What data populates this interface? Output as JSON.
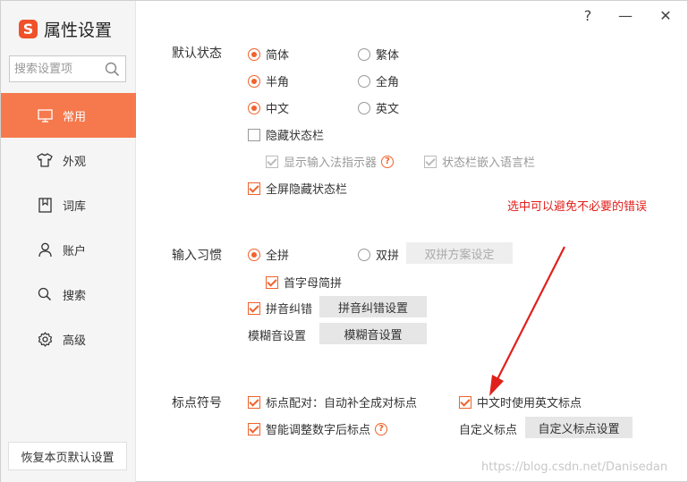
{
  "app": {
    "title": "属性设置",
    "logo_letter": "S"
  },
  "titlebar": {
    "help": "?",
    "minimize": "—",
    "close": "✕"
  },
  "sidebar": {
    "search_placeholder": "搜索设置项",
    "items": [
      {
        "label": "常用",
        "icon": "monitor-icon",
        "active": true
      },
      {
        "label": "外观",
        "icon": "tshirt-icon",
        "active": false
      },
      {
        "label": "词库",
        "icon": "book-icon",
        "active": false
      },
      {
        "label": "账户",
        "icon": "user-icon",
        "active": false
      },
      {
        "label": "搜索",
        "icon": "search-icon",
        "active": false
      },
      {
        "label": "高级",
        "icon": "gear-icon",
        "active": false
      }
    ],
    "restore_label": "恢复本页默认设置"
  },
  "default_state": {
    "title": "默认状态",
    "simplified": "简体",
    "traditional": "繁体",
    "half_width": "半角",
    "full_width": "全角",
    "chinese": "中文",
    "english": "英文",
    "hide_status_bar": "隐藏状态栏",
    "show_ime_indicator": "显示输入法指示器",
    "embed_language_bar": "状态栏嵌入语言栏",
    "fullscreen_hide_status_bar": "全屏隐藏状态栏"
  },
  "annotation": "选中可以避免不必要的错误",
  "input_habits": {
    "title": "输入习惯",
    "full_pinyin": "全拼",
    "double_pinyin": "双拼",
    "double_pinyin_settings": "双拼方案设定",
    "initial_letter_pinyin": "首字母简拼",
    "pinyin_correction": "拼音纠错",
    "pinyin_correction_settings": "拼音纠错设置",
    "fuzzy_label": "模糊音设置",
    "fuzzy_settings": "模糊音设置"
  },
  "punctuation": {
    "title": "标点符号",
    "auto_pair": "标点配对：自动补全成对标点",
    "english_punct_in_chinese": "中文时使用英文标点",
    "smart_after_number": "智能调整数字后标点",
    "custom_label": "自定义标点",
    "custom_settings": "自定义标点设置"
  },
  "colors": {
    "accent": "#f5794d",
    "check": "#f0622c",
    "annotation": "#e0201c"
  },
  "watermark": "https://blog.csdn.net/Danisedan"
}
